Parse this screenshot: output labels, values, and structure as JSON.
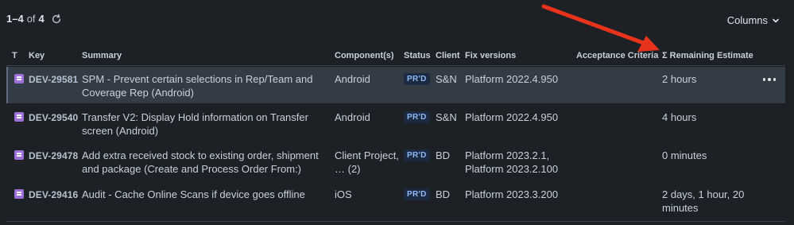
{
  "header": {
    "count_range": "1–4",
    "count_of": "of",
    "count_total": "4",
    "columns_label": "Columns",
    "accent_red": "#e8331c"
  },
  "table": {
    "headers": {
      "type": "T",
      "key": "Key",
      "summary": "Summary",
      "components": "Component(s)",
      "status": "Status",
      "client": "Client",
      "fix_versions": "Fix versions",
      "acceptance": "Acceptance Criteria",
      "remaining": "Σ Remaining Estimate"
    },
    "rows": [
      {
        "type_icon": "story-icon",
        "key": "DEV-29581",
        "summary_line1": "SPM - Prevent certain selections in Rep/Team and",
        "summary_line2": "Coverage Rep (Android)",
        "component_line1": "Android",
        "component_line2": "",
        "status": "PR'D",
        "client": "S&N",
        "fix_line1": "Platform 2022.4.950",
        "fix_line2": "",
        "remaining_line1": "2 hours",
        "remaining_line2": ""
      },
      {
        "type_icon": "story-icon",
        "key": "DEV-29540",
        "summary_line1": "Transfer V2: Display Hold information on Transfer",
        "summary_line2": "screen (Android)",
        "component_line1": "Android",
        "component_line2": "",
        "status": "PR'D",
        "client": "S&N",
        "fix_line1": "Platform 2022.4.950",
        "fix_line2": "",
        "remaining_line1": "4 hours",
        "remaining_line2": ""
      },
      {
        "type_icon": "story-icon",
        "key": "DEV-29478",
        "summary_line1": "Add extra received stock to existing order, shipment",
        "summary_line2": "and package (Create and Process Order From:)",
        "component_line1": "Client Project,",
        "component_line2": "… (2)",
        "status": "PR'D",
        "client": "BD",
        "fix_line1": "Platform 2023.2.1,",
        "fix_line2": "Platform 2023.2.100",
        "remaining_line1": "0 minutes",
        "remaining_line2": ""
      },
      {
        "type_icon": "story-icon",
        "key": "DEV-29416",
        "summary_line1": "Audit - Cache Online Scans if device goes offline",
        "summary_line2": "",
        "component_line1": "iOS",
        "component_line2": "",
        "status": "PR'D",
        "client": "BD",
        "fix_line1": "Platform 2023.3.200",
        "fix_line2": "",
        "remaining_line1": "2 days, 1 hour, 20",
        "remaining_line2": "minutes"
      }
    ]
  }
}
